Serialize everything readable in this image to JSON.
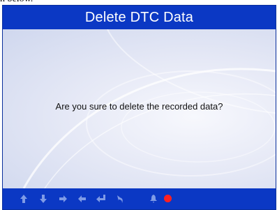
{
  "caption": "n below.",
  "title": "Delete DTC Data",
  "message": "Are you sure to delete the recorded data?",
  "colors": {
    "titlebar": "#0b38c4",
    "icon": "#7f9be6",
    "record": "#ff2020"
  },
  "bottom_bar": {
    "icons": [
      "up-arrow-icon",
      "down-arrow-icon",
      "right-arrow-icon",
      "left-arrow-icon",
      "enter-icon",
      "back-icon",
      "bell-icon",
      "record-icon"
    ]
  }
}
